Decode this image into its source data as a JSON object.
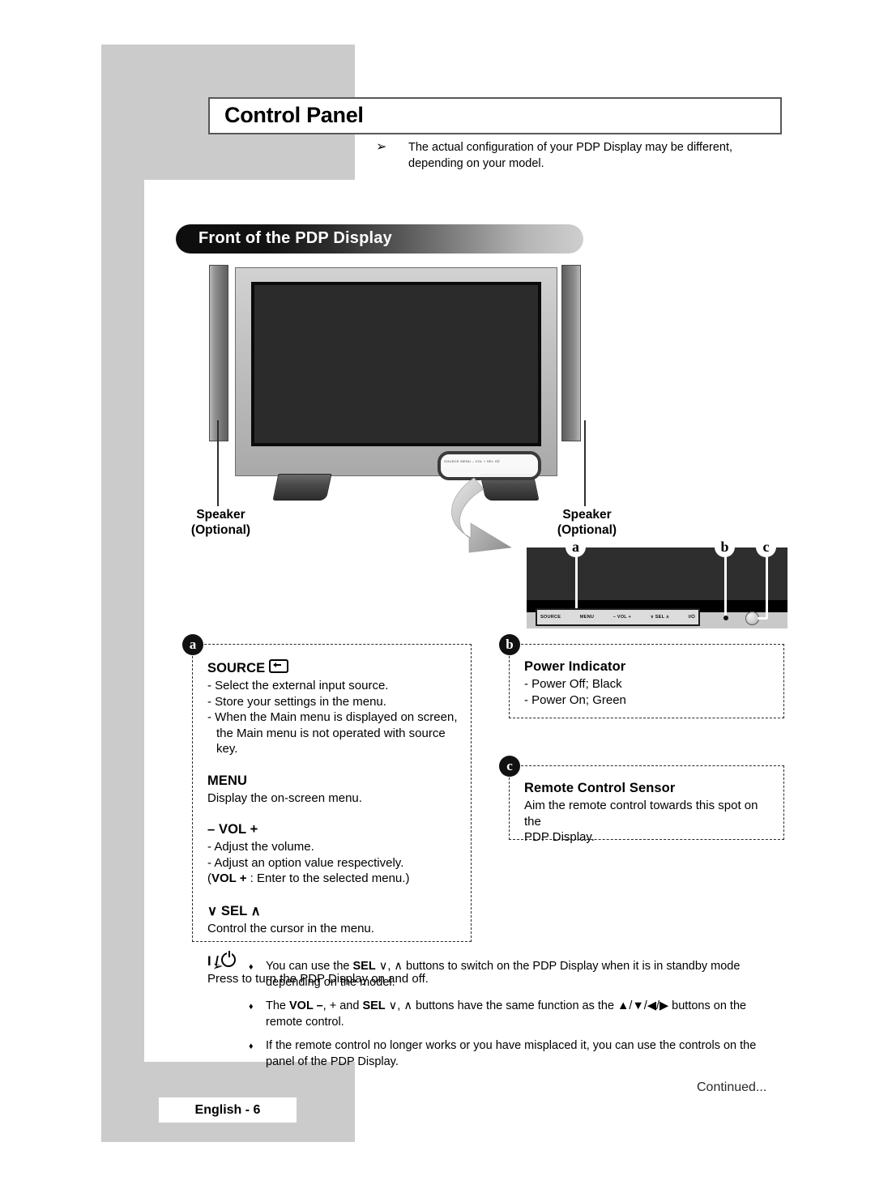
{
  "page": {
    "chapter_title": "Control Panel",
    "top_note": "The actual configuration of your PDP Display may be different, depending on your model.",
    "section_title": "Front of the PDP Display",
    "footer_page": "English - 6",
    "continued": "Continued..."
  },
  "illustration": {
    "speaker_left_line1": "Speaker",
    "speaker_left_line2": "(Optional)",
    "speaker_right_line1": "Speaker",
    "speaker_right_line2": "(Optional)",
    "mini_strip": "SOURCE   MENU   – VOL +   SEL   I/⏻"
  },
  "detail_panel": {
    "markers": {
      "a": "a",
      "b": "b",
      "c": "c"
    },
    "buttons": [
      "SOURCE",
      "MENU",
      "–  VOL  +",
      "∨ SEL ∧",
      "I/⏻"
    ]
  },
  "callouts": {
    "a": {
      "badge": "a",
      "source": {
        "heading": "SOURCE",
        "lines": [
          "- Select the external input source.",
          "- Store your settings in the menu.",
          "- When the Main menu is displayed on screen,",
          "the Main menu is not operated with source key."
        ]
      },
      "menu": {
        "heading": "MENU",
        "lines": [
          "Display the on-screen menu."
        ]
      },
      "vol": {
        "heading": "– VOL +",
        "lines": [
          "- Adjust the volume.",
          "- Adjust an option value respectively."
        ],
        "note_prefix": "(",
        "note_bold": "VOL +",
        "note_rest": " : Enter to the selected menu.)"
      },
      "sel": {
        "heading": "∨ SEL ∧",
        "lines": [
          "Control the cursor in the menu."
        ]
      },
      "power": {
        "heading": "I /",
        "lines": [
          "Press to turn the PDP Display on and off."
        ]
      }
    },
    "b": {
      "badge": "b",
      "heading": "Power Indicator",
      "lines": [
        "- Power Off; Black",
        "- Power On; Green"
      ]
    },
    "c": {
      "badge": "c",
      "heading": "Remote Control Sensor",
      "lines": [
        "Aim the remote control towards this spot on the",
        "PDP Display."
      ]
    }
  },
  "bottom_notes": [
    {
      "pre": "You can use the ",
      "b1": "SEL",
      "mid1": " ∨, ∧ ",
      "post": "buttons to switch on the PDP Display when it is in standby mode depending on the model."
    },
    {
      "pre": "The ",
      "b1": "VOL –",
      "mid1": ", + and ",
      "b2": "SEL",
      "mid2": " ∨, ∧ ",
      "post": "buttons have the same function as the ▲/▼/◀/▶ buttons on the remote control."
    },
    {
      "pre": "If the remote control no longer works or you have misplaced it, you can use the controls on the panel of the PDP Display."
    }
  ],
  "icons": {
    "note_arrow": "➢",
    "diamond": "♦"
  }
}
